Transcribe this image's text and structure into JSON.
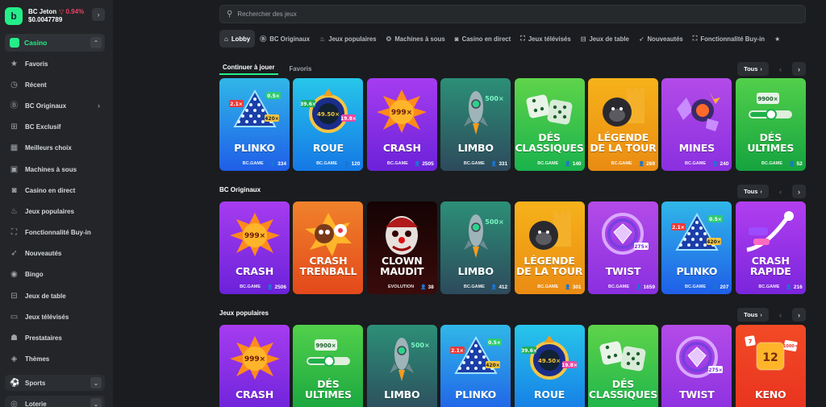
{
  "wallet": {
    "name": "BC Jeton",
    "change": "0.94%",
    "balance": "$0.0047789"
  },
  "sidebar": {
    "casino_label": "Casino",
    "items": [
      {
        "label": "Favoris",
        "icon": "star-icon",
        "glyph": "★"
      },
      {
        "label": "Récent",
        "icon": "clock-icon",
        "glyph": "◷"
      },
      {
        "label": "BC Originaux",
        "icon": "bc-icon",
        "glyph": "Ⓑ",
        "has_arrow": true
      },
      {
        "label": "BC Exclusif",
        "icon": "gamepad-icon",
        "glyph": "⊞"
      },
      {
        "label": "Meilleurs choix",
        "icon": "grid-icon",
        "glyph": "▦"
      },
      {
        "label": "Machines à sous",
        "icon": "slot-icon",
        "glyph": "▣"
      },
      {
        "label": "Casino en direct",
        "icon": "live-icon",
        "glyph": "◙"
      },
      {
        "label": "Jeux populaires",
        "icon": "fire-icon",
        "glyph": "♨"
      },
      {
        "label": "Fonctionnalité Buy-in",
        "icon": "buyin-icon",
        "glyph": "⛶"
      },
      {
        "label": "Nouveautés",
        "icon": "rocket-icon",
        "glyph": "➶"
      },
      {
        "label": "Bingo",
        "icon": "bingo-icon",
        "glyph": "◉"
      },
      {
        "label": "Jeux de table",
        "icon": "table-icon",
        "glyph": "⊟"
      },
      {
        "label": "Jeux télévisés",
        "icon": "tv-icon",
        "glyph": "▭"
      },
      {
        "label": "Prestataires",
        "icon": "provider-icon",
        "glyph": "☗"
      },
      {
        "label": "Thèmes",
        "icon": "theme-icon",
        "glyph": "◈"
      }
    ],
    "sports_label": "Sports",
    "lottery_label": "Loterie"
  },
  "search": {
    "placeholder": "Rechercher des jeux"
  },
  "tabs": [
    {
      "label": "Lobby",
      "glyph": "⌂",
      "icon": "home-icon",
      "active": true
    },
    {
      "label": "BC Originaux",
      "glyph": "Ⓑ",
      "icon": "bc-icon"
    },
    {
      "label": "Jeux populaires",
      "glyph": "♨",
      "icon": "fire-icon"
    },
    {
      "label": "Machines à sous",
      "glyph": "❂",
      "icon": "slot-icon"
    },
    {
      "label": "Casino en direct",
      "glyph": "◙",
      "icon": "live-icon"
    },
    {
      "label": "Jeux télévisés",
      "glyph": "⛶",
      "icon": "tv-icon"
    },
    {
      "label": "Jeux de table",
      "glyph": "⊟",
      "icon": "table-icon"
    },
    {
      "label": "Nouveautés",
      "glyph": "➶",
      "icon": "rocket-icon"
    },
    {
      "label": "Fonctionnalité Buy-in",
      "glyph": "⛶",
      "icon": "buyin-icon"
    },
    {
      "label": "",
      "glyph": "★",
      "icon": "star-icon"
    }
  ],
  "subtabs": [
    {
      "label": "Continuer à jouer",
      "active": true
    },
    {
      "label": "Favoris"
    }
  ],
  "all_label": "Tous",
  "sections": [
    {
      "title": "",
      "cards": [
        {
          "name": "PLINKO",
          "players": "334",
          "bg": [
            "#1f5ee8",
            "#30b7e8"
          ],
          "art": "plinko",
          "brand": "BC.GAME"
        },
        {
          "name": "ROUE",
          "players": "120",
          "bg": [
            "#1478e6",
            "#27c6ea"
          ],
          "art": "wheel",
          "brand": "BC.GAME"
        },
        {
          "name": "CRASH",
          "players": "2505",
          "bg": [
            "#6b22d9",
            "#a63cf0"
          ],
          "art": "crash",
          "brand": "BC.GAME"
        },
        {
          "name": "LIMBO",
          "players": "331",
          "bg": [
            "#2d4a5c",
            "#2c8f77"
          ],
          "art": "rocket",
          "brand": "BC.GAME"
        },
        {
          "name": "DÉS CLASSIQUES",
          "players": "140",
          "bg": [
            "#19b24c",
            "#5fd44a"
          ],
          "art": "dice",
          "brand": "BC.GAME"
        },
        {
          "name": "LÉGENDE DE LA TOUR",
          "players": "269",
          "bg": [
            "#ea8b13",
            "#f6b21a"
          ],
          "art": "gorilla",
          "brand": "BC.GAME"
        },
        {
          "name": "MINES",
          "players": "240",
          "bg": [
            "#8a2fe0",
            "#b34be8"
          ],
          "art": "mines",
          "brand": "BC.GAME"
        },
        {
          "name": "DÉS ULTIMES",
          "players": "52",
          "bg": [
            "#15a33f",
            "#52d04b"
          ],
          "art": "slider",
          "brand": "BC.GAME"
        }
      ]
    },
    {
      "title": "BC Originaux",
      "cards": [
        {
          "name": "CRASH",
          "players": "2506",
          "bg": [
            "#6b22d9",
            "#a63cf0"
          ],
          "art": "crash",
          "brand": "BC.GAME"
        },
        {
          "name": "CRASH TRENBALL",
          "players": "",
          "bg": [
            "#e3481b",
            "#f0822b"
          ],
          "art": "trenball",
          "brand": ""
        },
        {
          "name": "CLOWN MAUDIT",
          "players": "38",
          "bg": [
            "#3a0b0b",
            "#150303"
          ],
          "art": "clown",
          "brand": "EVOLUTION"
        },
        {
          "name": "LIMBO",
          "players": "412",
          "bg": [
            "#2d4a5c",
            "#2c8f77"
          ],
          "art": "rocket",
          "brand": "BC.GAME"
        },
        {
          "name": "LÉGENDE DE LA TOUR",
          "players": "301",
          "bg": [
            "#ea8b13",
            "#f6b21a"
          ],
          "art": "gorilla",
          "brand": "BC.GAME"
        },
        {
          "name": "TWIST",
          "players": "1659",
          "bg": [
            "#8a2fe0",
            "#b34be8"
          ],
          "art": "twist",
          "brand": "BC.GAME"
        },
        {
          "name": "PLINKO",
          "players": "207",
          "bg": [
            "#1f5ee8",
            "#30b7e8"
          ],
          "art": "plinko",
          "brand": "BC.GAME"
        },
        {
          "name": "CRASH RAPIDE",
          "players": "216",
          "bg": [
            "#7a25dc",
            "#b23ff0"
          ],
          "art": "rapid",
          "brand": "BC.GAME"
        }
      ]
    },
    {
      "title": "Jeux populaires",
      "cards": [
        {
          "name": "CRASH",
          "players": "",
          "bg": [
            "#6b22d9",
            "#a63cf0"
          ],
          "art": "crash",
          "brand": ""
        },
        {
          "name": "DÉS ULTIMES",
          "players": "",
          "bg": [
            "#15a33f",
            "#52d04b"
          ],
          "art": "slider",
          "brand": ""
        },
        {
          "name": "LIMBO",
          "players": "",
          "bg": [
            "#2d4a5c",
            "#2c8f77"
          ],
          "art": "rocket",
          "brand": ""
        },
        {
          "name": "PLINKO",
          "players": "",
          "bg": [
            "#1f5ee8",
            "#30b7e8"
          ],
          "art": "plinko",
          "brand": ""
        },
        {
          "name": "ROUE",
          "players": "",
          "bg": [
            "#1478e6",
            "#27c6ea"
          ],
          "art": "wheel",
          "brand": ""
        },
        {
          "name": "DÉS CLASSIQUES",
          "players": "",
          "bg": [
            "#19b24c",
            "#5fd44a"
          ],
          "art": "dice",
          "brand": ""
        },
        {
          "name": "TWIST",
          "players": "",
          "bg": [
            "#8a2fe0",
            "#b34be8"
          ],
          "art": "twist",
          "brand": ""
        },
        {
          "name": "KENO",
          "players": "",
          "bg": [
            "#e8321f",
            "#f24a26"
          ],
          "art": "keno",
          "brand": ""
        }
      ]
    }
  ],
  "art_text": {
    "plinko": [
      "2.1×",
      "0.5×",
      "420×"
    ],
    "wheel": [
      "39.6×",
      "49.50×",
      "19.8×"
    ],
    "crash": [
      "999×"
    ],
    "rocket": [
      "500×"
    ],
    "twist": [
      "275×"
    ],
    "slider": [
      "9900×"
    ],
    "keno": [
      "12",
      "7",
      "1000×"
    ]
  },
  "colors": {
    "accent": "#24ee89",
    "negative": "#ed4163"
  }
}
